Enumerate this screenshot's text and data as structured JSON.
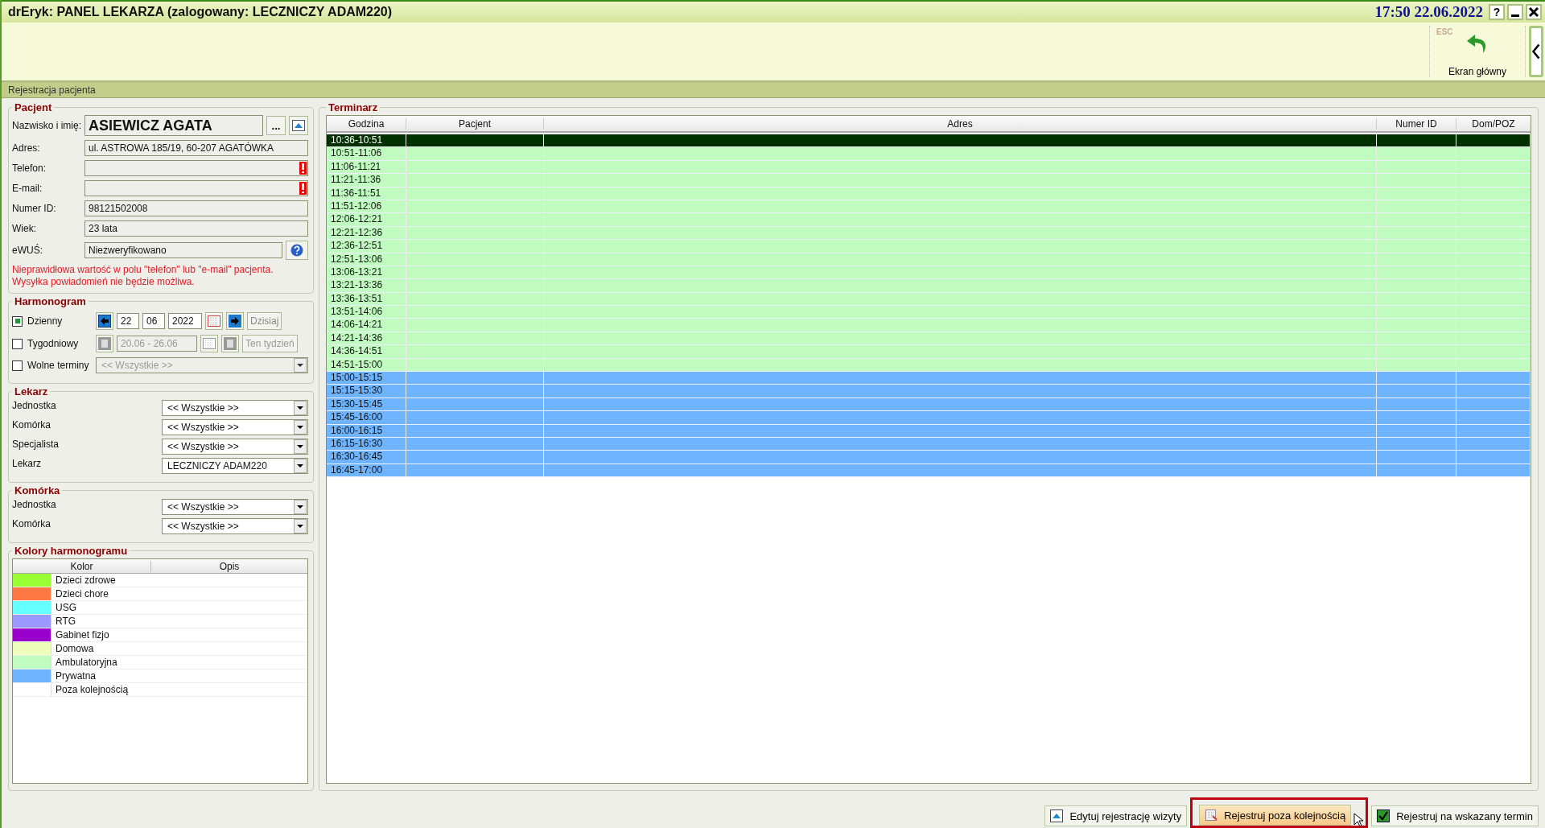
{
  "window": {
    "title": "drEryk: PANEL LEKARZA (zalogowany: LECZNICZY ADAM220)",
    "datetime": "17:50 22.06.2022",
    "help": "?"
  },
  "toolbar": {
    "shortcut": "ESC",
    "home_button": "Ekran główny"
  },
  "section_title": "Rejestracja pacjenta",
  "patient": {
    "legend": "Pacjent",
    "browse_button": "...",
    "fields": [
      {
        "label": "Nazwisko i imię:",
        "value": "ASIEWICZ AGATA",
        "kind": "name"
      },
      {
        "label": "Adres:",
        "value": "ul. ASTROWA 185/19, 60-207 AGATÓWKA",
        "kind": "text"
      },
      {
        "label": "Telefon:",
        "kind": "warning"
      },
      {
        "label": "E-mail:",
        "kind": "warning"
      },
      {
        "label": "Numer ID:",
        "value": "98121502008",
        "kind": "text"
      },
      {
        "label": "Wiek:",
        "value": "23 lata",
        "kind": "text"
      },
      {
        "label": "eWUŚ:",
        "value": "Niezweryfikowano",
        "kind": "help"
      }
    ],
    "warning": [
      "Nieprawidłowa wartość w polu \"telefon\" lub \"e-mail\" pacjenta.",
      "Wysyłka powiadomień nie będzie możliwa."
    ]
  },
  "harmonogram": {
    "legend": "Harmonogram",
    "daily": {
      "label": "Dzienny",
      "checked": true,
      "day": "22",
      "month": "06",
      "year": "2022",
      "today_button": "Dzisiaj"
    },
    "weekly": {
      "label": "Tygodniowy",
      "checked": false,
      "range": "20.06 - 26.06",
      "button": "Ten tydzień",
      "disabled": true
    },
    "free": {
      "label": "Wolne terminy",
      "checked": false,
      "value": "<< Wszystkie >>",
      "disabled": true
    }
  },
  "doctor": {
    "legend": "Lekarz",
    "fields": [
      {
        "label": "Jednostka",
        "value": "<< Wszystkie >>"
      },
      {
        "label": "Komórka",
        "value": "<< Wszystkie >>"
      },
      {
        "label": "Specjalista",
        "value": "<< Wszystkie >>"
      },
      {
        "label": "Lekarz",
        "value": "LECZNICZY ADAM220"
      }
    ]
  },
  "unit": {
    "legend": "Komórka",
    "fields": [
      {
        "label": "Jednostka",
        "value": "<< Wszystkie >>"
      },
      {
        "label": "Komórka",
        "value": "<< Wszystkie >>"
      }
    ]
  },
  "colors": {
    "legend": "Kolory harmonogramu",
    "columns": [
      "Kolor",
      "Opis"
    ],
    "items": [
      {
        "color": "#99ff33",
        "label": "Dzieci zdrowe"
      },
      {
        "color": "#ff7744",
        "label": "Dzieci chore"
      },
      {
        "color": "#66ffff",
        "label": "USG"
      },
      {
        "color": "#9999ff",
        "label": "RTG"
      },
      {
        "color": "#9900cc",
        "label": "Gabinet fizjo"
      },
      {
        "color": "#eeffbb",
        "label": "Domowa"
      },
      {
        "color": "#c0fcc0",
        "label": "Ambulatoryjna"
      },
      {
        "color": "#6fb4ff",
        "label": "Prywatna"
      },
      {
        "color": "#ffffff",
        "label": "Poza kolejnością"
      }
    ]
  },
  "schedule": {
    "legend": "Terminarz",
    "columns": [
      "Godzina",
      "Pacjent",
      "Adres",
      "Numer ID",
      "Dom/POZ"
    ],
    "rows": [
      {
        "time": "10:36-10:51",
        "selected": true
      },
      {
        "time": "10:51-11:06",
        "color": "#c0fcc0",
        "selected": false
      },
      {
        "time": "11:06-11:21",
        "color": "#c0fcc0",
        "selected": false
      },
      {
        "time": "11:21-11:36",
        "color": "#c0fcc0",
        "selected": false
      },
      {
        "time": "11:36-11:51",
        "color": "#c0fcc0",
        "selected": false
      },
      {
        "time": "11:51-12:06",
        "color": "#c0fcc0",
        "selected": false
      },
      {
        "time": "12:06-12:21",
        "color": "#c0fcc0",
        "selected": false
      },
      {
        "time": "12:21-12:36",
        "color": "#c0fcc0",
        "selected": false
      },
      {
        "time": "12:36-12:51",
        "color": "#c0fcc0",
        "selected": false
      },
      {
        "time": "12:51-13:06",
        "color": "#c0fcc0",
        "selected": false
      },
      {
        "time": "13:06-13:21",
        "color": "#c0fcc0",
        "selected": false
      },
      {
        "time": "13:21-13:36",
        "color": "#c0fcc0",
        "selected": false
      },
      {
        "time": "13:36-13:51",
        "color": "#c0fcc0",
        "selected": false
      },
      {
        "time": "13:51-14:06",
        "color": "#c0fcc0",
        "selected": false
      },
      {
        "time": "14:06-14:21",
        "color": "#c0fcc0",
        "selected": false
      },
      {
        "time": "14:21-14:36",
        "color": "#c0fcc0",
        "selected": false
      },
      {
        "time": "14:36-14:51",
        "color": "#c0fcc0",
        "selected": false
      },
      {
        "time": "14:51-15:00",
        "color": "#c0fcc0",
        "selected": false
      },
      {
        "time": "15:00-15:15",
        "color": "#6fb4ff",
        "selected": false
      },
      {
        "time": "15:15-15:30",
        "color": "#6fb4ff",
        "selected": false
      },
      {
        "time": "15:30-15:45",
        "color": "#6fb4ff",
        "selected": false
      },
      {
        "time": "15:45-16:00",
        "color": "#6fb4ff",
        "selected": false
      },
      {
        "time": "16:00-16:15",
        "color": "#6fb4ff",
        "selected": false
      },
      {
        "time": "16:15-16:30",
        "color": "#6fb4ff",
        "selected": false
      },
      {
        "time": "16:30-16:45",
        "color": "#6fb4ff",
        "selected": false
      },
      {
        "time": "16:45-17:00",
        "color": "#6fb4ff",
        "selected": false
      }
    ]
  },
  "footer_buttons": [
    {
      "label": "Edytuj rejestrację wizyty",
      "kind": "edit",
      "highlighted": false
    },
    {
      "label": "Rejestruj poza kolejnością",
      "kind": "urgent",
      "highlighted": true
    },
    {
      "label": "Rejestruj na wskazany termin",
      "kind": "confirm",
      "highlighted": false
    }
  ]
}
